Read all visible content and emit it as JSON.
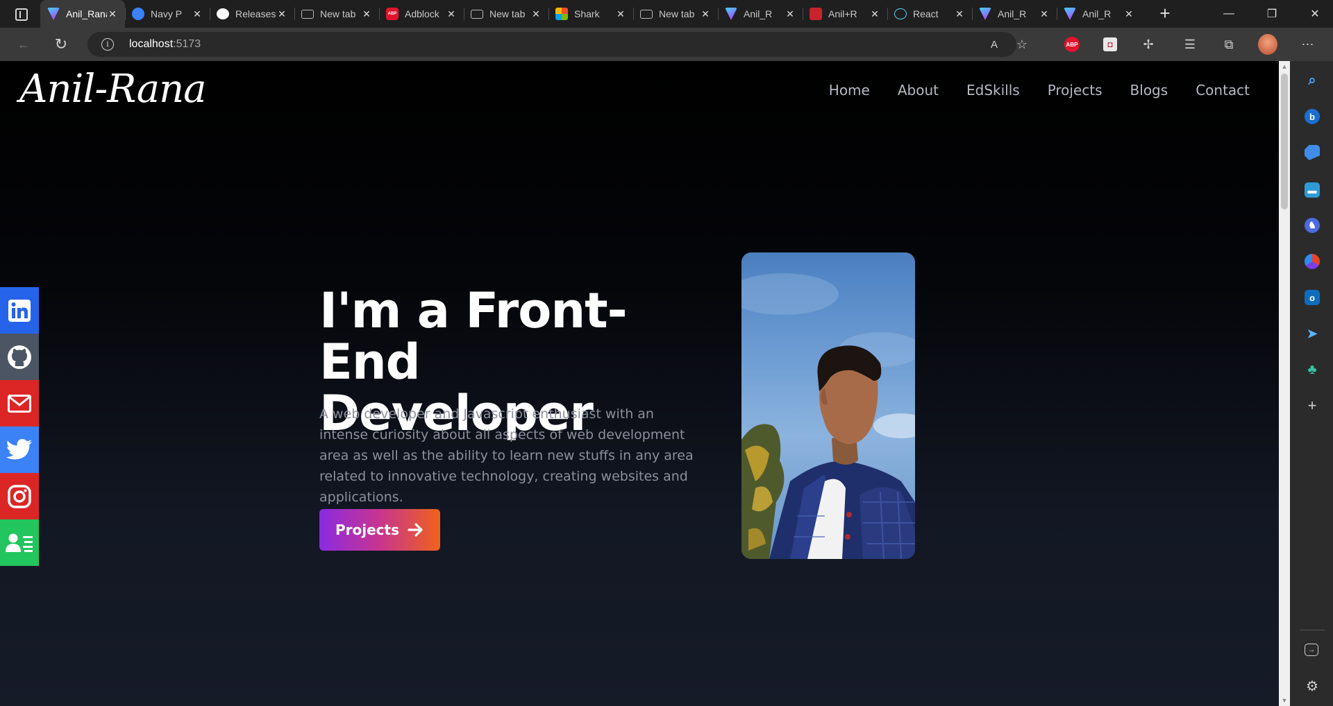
{
  "browser": {
    "tabs": [
      {
        "title": "Anil_Rana",
        "favicon": "vite-icon",
        "active": true
      },
      {
        "title": "Navy P",
        "favicon": "navy-icon",
        "active": false
      },
      {
        "title": "Releases",
        "favicon": "github-icon",
        "active": false
      },
      {
        "title": "New tab",
        "favicon": "newtab-icon",
        "active": false
      },
      {
        "title": "Adblock",
        "favicon": "abp-icon",
        "active": false
      },
      {
        "title": "New tab",
        "favicon": "newtab-icon",
        "active": false
      },
      {
        "title": "Shark",
        "favicon": "microsoft-icon",
        "active": false
      },
      {
        "title": "New tab",
        "favicon": "newtab-icon",
        "active": false
      },
      {
        "title": "Anil_R",
        "favicon": "vite-icon",
        "active": false
      },
      {
        "title": "Anil+R",
        "favicon": "pdf-icon",
        "active": false
      },
      {
        "title": "React",
        "favicon": "react-icon",
        "active": false
      },
      {
        "title": "Anil_R",
        "favicon": "vite-icon",
        "active": false
      },
      {
        "title": "Anil_R",
        "favicon": "vite-icon",
        "active": false
      }
    ],
    "address": {
      "host": "localhost",
      "port": ":5173"
    },
    "extension_labels": {
      "abp": "ABP"
    }
  },
  "site": {
    "logo": "Anil-Rana",
    "nav": [
      "Home",
      "About",
      "EdSkills",
      "Projects",
      "Blogs",
      "Contact"
    ],
    "hero": {
      "heading_line1": "I'm a Front-",
      "heading_line2": "End Developer",
      "description": "A web developer and Javascript enthusiast with an intense curiosity about all aspects of web development area as well as the ability to learn new stuffs in any area related to innovative technology, creating websites and applications.",
      "button_label": "Projects"
    },
    "social": [
      {
        "name": "linkedin",
        "color": "#2563eb"
      },
      {
        "name": "github",
        "color": "#4b5563"
      },
      {
        "name": "mail",
        "color": "#dc2626"
      },
      {
        "name": "twitter",
        "color": "#3b82f6"
      },
      {
        "name": "instagram",
        "color": "#dc2626"
      },
      {
        "name": "resume",
        "color": "#22c55e"
      }
    ]
  },
  "edge_sidebar": [
    "search-icon",
    "bing-icon",
    "shopping-icon",
    "tools-icon",
    "games-icon",
    "office-icon",
    "outlook-icon",
    "send-icon",
    "tree-icon",
    "add-icon",
    "hide-sidebar-icon",
    "settings-icon"
  ]
}
